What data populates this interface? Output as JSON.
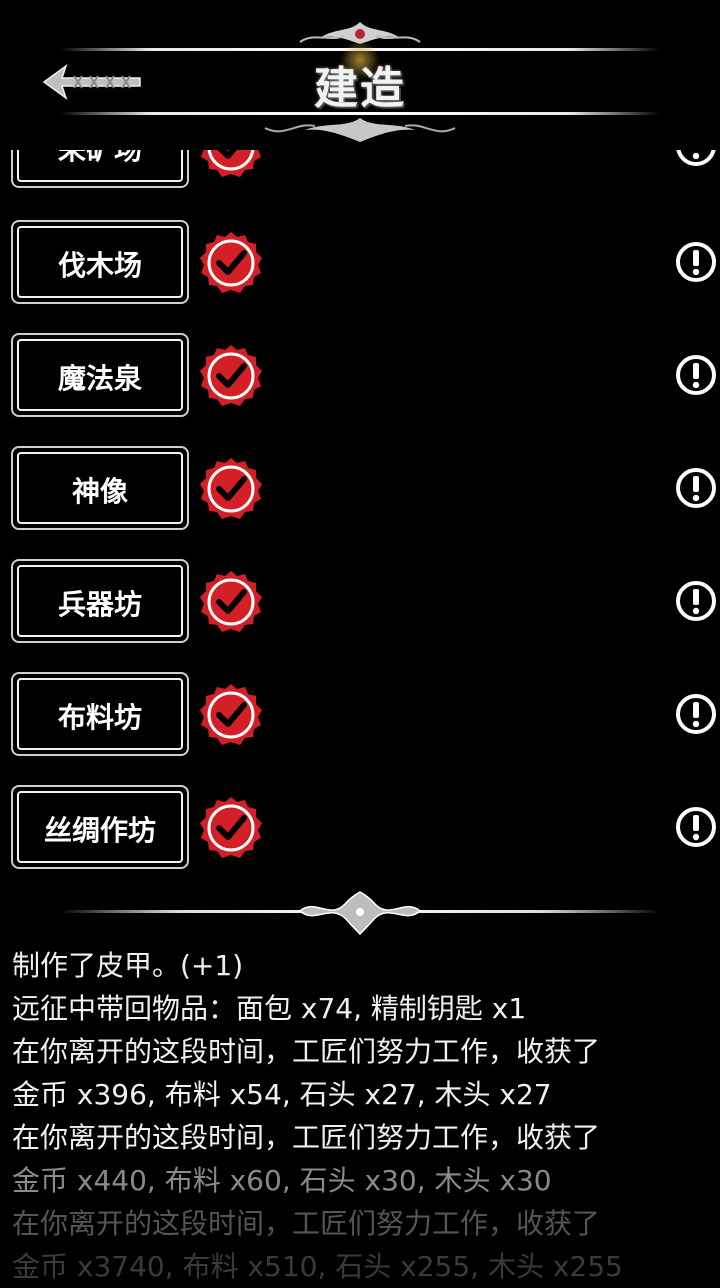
{
  "header": {
    "title": "建造",
    "back_label": "×××",
    "back_icon": "back-arrow-icon"
  },
  "buildings": [
    {
      "label": "采矿场",
      "status_icon": "check-seal-icon",
      "info_icon": "info-icon"
    },
    {
      "label": "伐木场",
      "status_icon": "check-seal-icon",
      "info_icon": "info-icon"
    },
    {
      "label": "魔法泉",
      "status_icon": "check-seal-icon",
      "info_icon": "info-icon"
    },
    {
      "label": "神像",
      "status_icon": "check-seal-icon",
      "info_icon": "info-icon"
    },
    {
      "label": "兵器坊",
      "status_icon": "check-seal-icon",
      "info_icon": "info-icon"
    },
    {
      "label": "布料坊",
      "status_icon": "check-seal-icon",
      "info_icon": "info-icon"
    },
    {
      "label": "丝绸作坊",
      "status_icon": "check-seal-icon",
      "info_icon": "info-icon"
    }
  ],
  "log": [
    "制作了皮甲。(+1)",
    "远征中带回物品：面包 x74, 精制钥匙 x1",
    "在你离开的这段时间，工匠们努力工作，收获了",
    "金币 x396, 布料 x54, 石头 x27, 木头 x27",
    "在你离开的这段时间，工匠们努力工作，收获了",
    "金币 x440, 布料 x60, 石头 x30, 木头 x30",
    "在你离开的这段时间，工匠们努力工作，收获了",
    "金币 x3740, 布料 x510, 石头 x255, 木头 x255"
  ],
  "colors": {
    "seal_red": "#d32027",
    "background": "#000000",
    "text": "#ffffff"
  }
}
